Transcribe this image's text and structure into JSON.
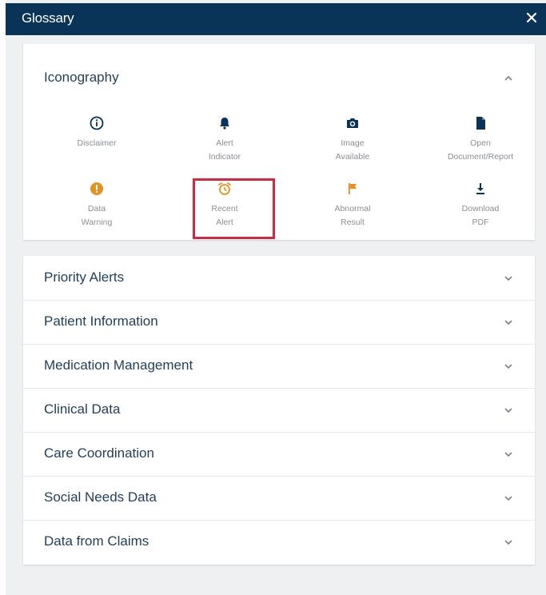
{
  "header": {
    "title": "Glossary",
    "close_label": "×"
  },
  "iconography": {
    "title": "Iconography",
    "items": [
      {
        "label": "Disclaimer",
        "icon": "info-circle-icon",
        "color": "#0a3358"
      },
      {
        "label": "Alert\nIndicator",
        "icon": "bell-icon",
        "color": "#0a3358"
      },
      {
        "label": "Image\nAvailable",
        "icon": "camera-icon",
        "color": "#0a3358"
      },
      {
        "label": "Open\nDocument/Report",
        "icon": "document-icon",
        "color": "#0a3358"
      },
      {
        "label": "Data\nWarning",
        "icon": "warning-circle-icon",
        "color": "#e8901c"
      },
      {
        "label": "Recent\nAlert",
        "icon": "alarm-clock-icon",
        "color": "#e8901c"
      },
      {
        "label": "Abnormal\nResult",
        "icon": "flag-icon",
        "color": "#e8901c"
      },
      {
        "label": "Download\nPDF",
        "icon": "download-icon",
        "color": "#0a3358"
      }
    ]
  },
  "sections": [
    {
      "label": "Priority Alerts"
    },
    {
      "label": "Patient Information"
    },
    {
      "label": "Medication Management"
    },
    {
      "label": "Clinical Data"
    },
    {
      "label": "Care Coordination"
    },
    {
      "label": "Social Needs Data"
    },
    {
      "label": "Data from Claims"
    }
  ],
  "colors": {
    "header_bg": "#0a3358",
    "accent_orange": "#e8901c",
    "highlight_red": "#d7263d",
    "text_primary": "#1f3e5c"
  }
}
